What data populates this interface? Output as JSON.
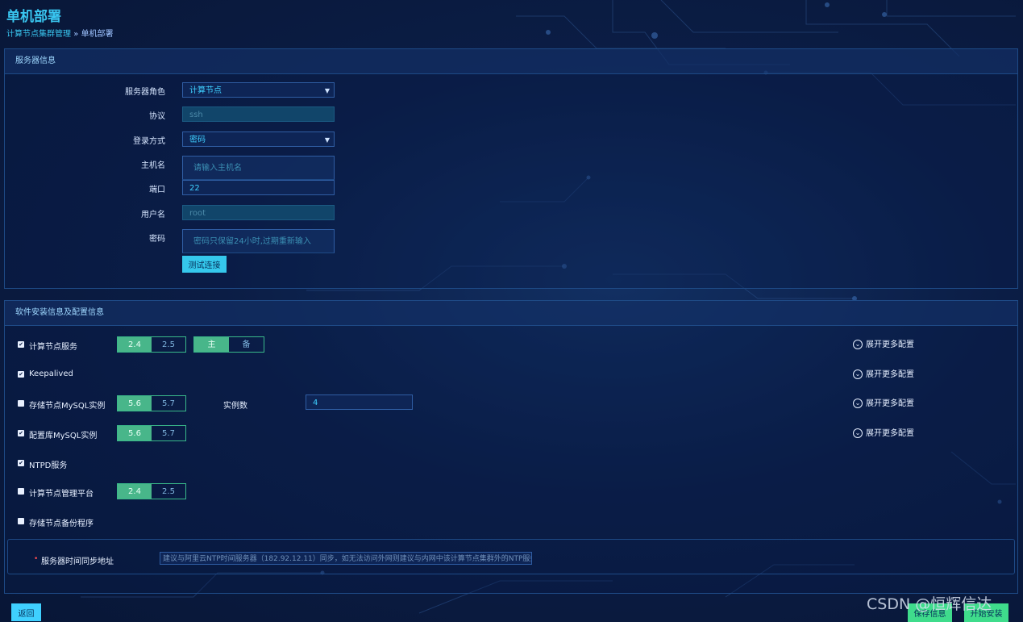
{
  "page": {
    "title": "单机部署"
  },
  "breadcrumb": {
    "parent": "计算节点集群管理",
    "separator": "»",
    "current": "单机部署"
  },
  "server_panel": {
    "title": "服务器信息",
    "fields": [
      {
        "label": "服务器角色",
        "value": "计算节点",
        "kind": "select"
      },
      {
        "label": "协议",
        "value": "ssh",
        "kind": "disabled"
      },
      {
        "label": "登录方式",
        "value": "密码",
        "kind": "select"
      },
      {
        "label": "主机名",
        "placeholder": "请输入主机名",
        "kind": "input"
      },
      {
        "label": "端口",
        "value": "22",
        "kind": "input"
      },
      {
        "label": "用户名",
        "value": "root",
        "kind": "disabled"
      },
      {
        "label": "密码",
        "placeholder": "密码只保留24小时,过期重新输入",
        "kind": "input"
      }
    ],
    "test_button": "测试连接"
  },
  "software_panel": {
    "title": "软件安装信息及配置信息",
    "expand_label": "展开更多配置",
    "rows": [
      {
        "label": "计算节点服务",
        "checked": true,
        "versions": [
          "2.4",
          "2.5"
        ],
        "selected_version": "2.4",
        "roles": [
          "主",
          "备"
        ],
        "selected_role": "主",
        "expand": true
      },
      {
        "label": "Keepalived",
        "checked": true,
        "expand": true
      },
      {
        "label": "存储节点MySQL实例",
        "checked": false,
        "versions": [
          "5.6",
          "5.7"
        ],
        "selected_version": "5.6",
        "instance_label": "实例数",
        "instance_value": "4",
        "expand": true
      },
      {
        "label": "配置库MySQL实例",
        "checked": true,
        "versions": [
          "5.6",
          "5.7"
        ],
        "selected_version": "5.6",
        "expand": true
      },
      {
        "label": "NTPD服务",
        "checked": true
      },
      {
        "label": "计算节点管理平台",
        "checked": false,
        "versions": [
          "2.4",
          "2.5"
        ],
        "selected_version": "2.4"
      },
      {
        "label": "存储节点备份程序",
        "checked": false
      }
    ],
    "ntp": {
      "required_mark": "•",
      "label": "服务器时间同步地址",
      "placeholder": "建议与阿里云NTP时间服务器（182.92.12.11）同步，如无法访问外网则建议与内网中该计算节点集群外的NTP服务"
    }
  },
  "footer": {
    "back": "返回",
    "save": "保存信息",
    "install": "开始安装"
  },
  "watermark": "CSDN @恒辉信达",
  "colors": {
    "accent": "#39c6f0",
    "segment_on": "#48b68a",
    "primary_button": "#3fdc8c",
    "background": "#0b1d45"
  }
}
